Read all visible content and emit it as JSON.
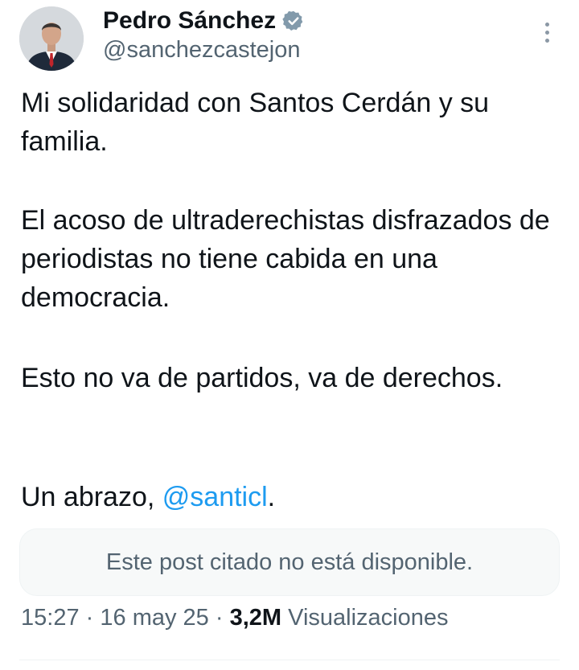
{
  "author": {
    "name": "Pedro Sánchez",
    "handle": "@sanchezcastejon",
    "verified": true,
    "avatar_icon": "profile-photo"
  },
  "tweet": {
    "paragraph1": "Mi solidaridad con Santos Cerdán y su familia.",
    "paragraph2": "El acoso de ultraderechistas disfrazados de periodistas no tiene cabida en una democracia.",
    "paragraph3": "Esto no va de partidos, va de derechos.",
    "paragraph4_prefix": "Un abrazo, ",
    "mention": "@santicl",
    "paragraph4_suffix": "."
  },
  "quoted_post": {
    "text": "Este post citado no está disponible."
  },
  "meta": {
    "time": "15:27",
    "separator": "·",
    "date": "16 may 25",
    "views_count": "3,2M",
    "views_label": "Visualizaciones"
  },
  "colors": {
    "text_primary": "#0f1419",
    "text_secondary": "#536471",
    "link": "#1d9bf0",
    "verified_badge": "#829aab"
  }
}
